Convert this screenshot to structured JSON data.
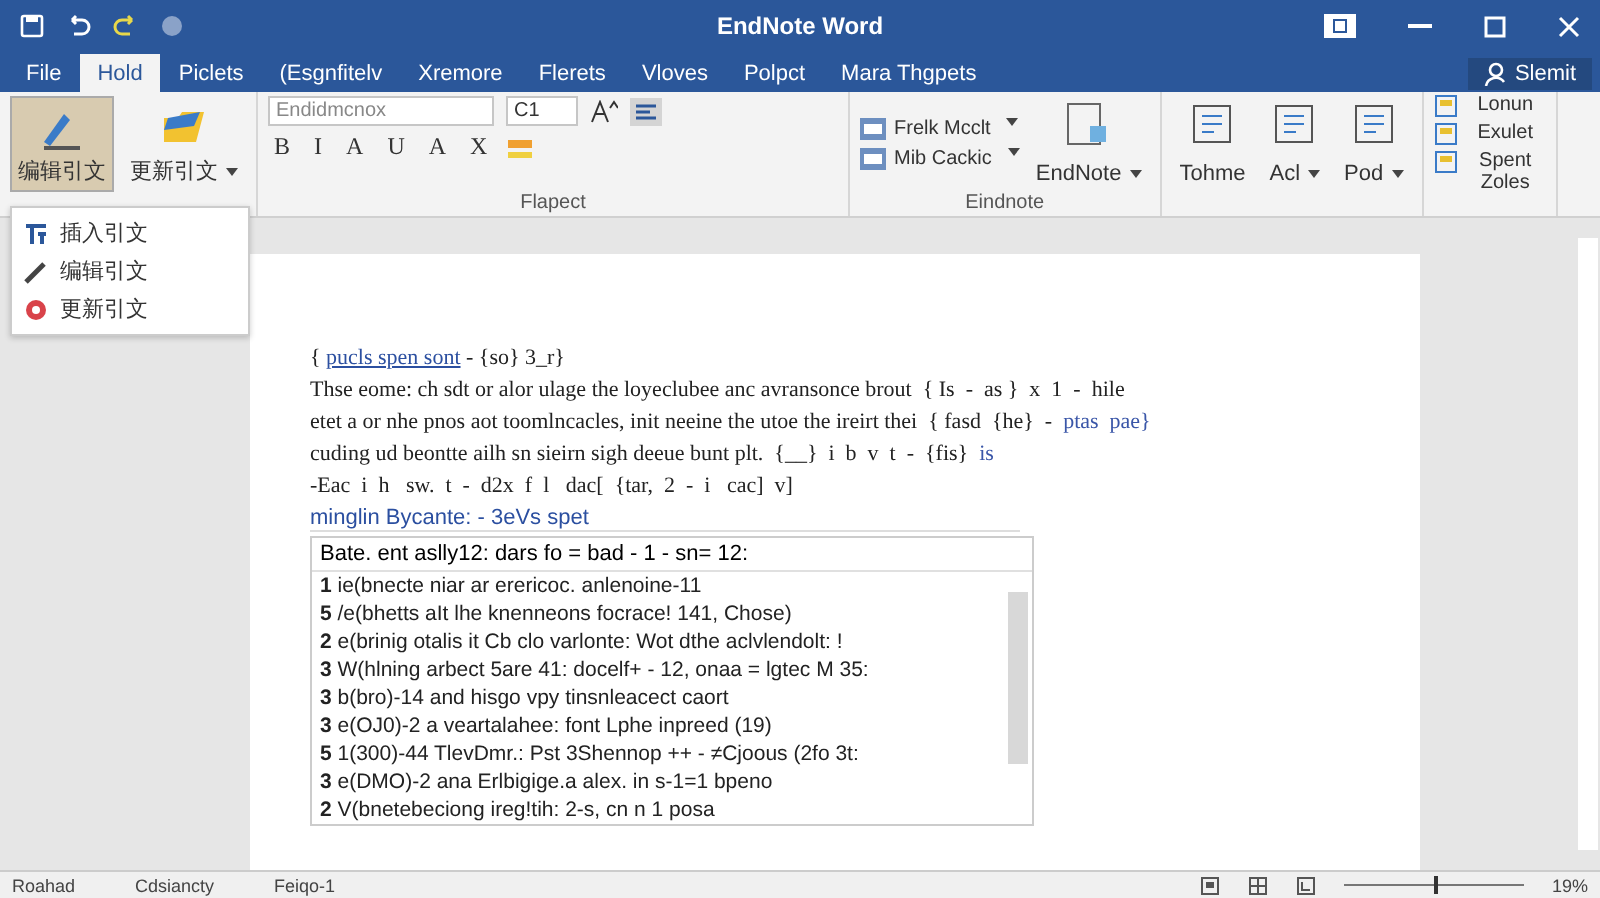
{
  "window": {
    "title": "EndNote Word",
    "account": "Slemit"
  },
  "tabs": [
    {
      "label": "File",
      "selected": false
    },
    {
      "label": "Hold",
      "selected": true
    },
    {
      "label": "Piclets",
      "selected": false
    },
    {
      "label": "(Esgnfitelv",
      "selected": false
    },
    {
      "label": "Xremore",
      "selected": false
    },
    {
      "label": "Flerets",
      "selected": false
    },
    {
      "label": "Vloves",
      "selected": false
    },
    {
      "label": "Polpct",
      "selected": false
    },
    {
      "label": "Mara Thgpets",
      "selected": false
    }
  ],
  "ribbon": {
    "big_buttons": [
      {
        "label": "编辑引文",
        "selected": true,
        "caret": false
      },
      {
        "label": "更新引文",
        "selected": false,
        "caret": true
      }
    ],
    "font_group": {
      "font": "Endidmcnox",
      "size": "C1",
      "label": "Flapect",
      "format_buttons": [
        "B",
        "I",
        "A",
        "U",
        "A",
        "X"
      ]
    },
    "endnote_group": {
      "items": [
        "Frelk Mcclt",
        "Mib Cackic"
      ],
      "big": "EndNote",
      "label": "Eindnote"
    },
    "tools": [
      "Tohme",
      "Acl",
      "Pod"
    ],
    "side": [
      "Lonun",
      "Exulet",
      "Spent Zoles"
    ]
  },
  "menu": [
    {
      "label": "插入引文"
    },
    {
      "label": "编辑引文"
    },
    {
      "label": "更新引文"
    }
  ],
  "document": {
    "lines": [
      [
        {
          "text": "{ ",
          "kind": "text"
        },
        {
          "text": "pucls spen sont",
          "kind": "link"
        },
        {
          "text": " - {so} 3_r}",
          "kind": "text"
        }
      ],
      [
        {
          "text": "Thse eome: ch sdt or alor ulage the loyeclubee anc avransonce brout  { Is  -  as }  x  1  -  hile",
          "kind": "text"
        }
      ],
      [
        {
          "text": "etet a or nhe pnos aot toomlncacles, init neeine the utoe the ireirt thei  { fasd  {he}  -  ",
          "kind": "text"
        },
        {
          "text": "ptas  pae}",
          "kind": "blue"
        }
      ],
      [
        {
          "text": "cuding ud beontte ailh sn sieirn sigh deeue bunt plt.  {__}  i  b  v  t  -  {fis}  ",
          "kind": "text"
        },
        {
          "text": "is",
          "kind": "blue"
        }
      ],
      [
        {
          "text": "-Eac  i  h   sw.  t  -  d2x  f  l   dac[  {tar,  2  -  i   cac]  v]",
          "kind": "text"
        }
      ]
    ],
    "heading": "minglin Bycante: - 3eVs spet",
    "list": {
      "header": "Bate. ent aslly12: dars fo = bad - 1 - sn= 12:",
      "rows": [
        {
          "num": "1",
          "text": "ie(bnecte niar ar erericoc. anlenoine-11"
        },
        {
          "num": "5",
          "text": "/e(bhetts aIt lhe knenneons focrace! 141, Chose)"
        },
        {
          "num": "2",
          "text": "e(brinig otalis it Cb clo varlonte: Wot dthe aclvlendolt: !"
        },
        {
          "num": "3",
          "text": "W(hlning arbect 5are 41: docelf+ - 12, onaa = lgtec M 35:"
        },
        {
          "num": "3",
          "text": "b(bro)-14 and hisgo vpy tinsnleacect caort"
        },
        {
          "num": "3",
          "text": "e(OJ0)-2 a veartalahee: font Lphe inpreed (19)"
        },
        {
          "num": "5",
          "text": "1(300)-44 TlevDmr.: Pst 3Shennop ++ - ≠Cjoous (2fo 3t:"
        },
        {
          "num": "3",
          "text": "e(DMO)-2 ana Erlbigige.a alex. in s-1=1 bpeno"
        },
        {
          "num": "2",
          "text": "V(bnetebeciong ireg!tih: 2-s, cn n 1 posa"
        }
      ]
    }
  },
  "status_bar": {
    "items": [
      "Roahad",
      "Cdsiancty",
      "Feiqo-1"
    ],
    "zoom": {
      "level": 0.5
    },
    "zoom_text": "19%"
  }
}
